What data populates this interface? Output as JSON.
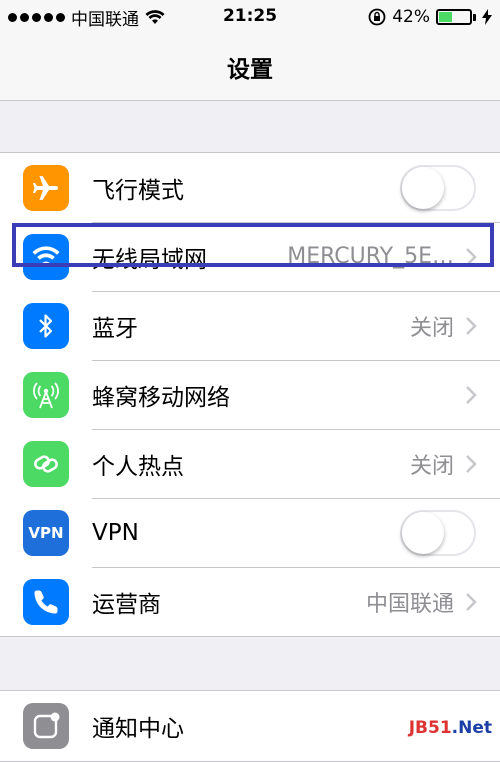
{
  "status_bar": {
    "carrier": "中国联通",
    "time": "21:25",
    "battery_percent": "42%",
    "battery_level": 0.42
  },
  "nav": {
    "title": "设置"
  },
  "settings": [
    {
      "label": "飞行模式",
      "icon": "airplane-icon",
      "icon_bg": "#ff9500",
      "type": "toggle",
      "on": false
    },
    {
      "label": "无线局域网",
      "icon": "wifi-icon",
      "icon_bg": "#007aff",
      "type": "detail",
      "value": "MERCURY_5E…"
    },
    {
      "label": "蓝牙",
      "icon": "bluetooth-icon",
      "icon_bg": "#007aff",
      "type": "detail",
      "value": "关闭"
    },
    {
      "label": "蜂窝移动网络",
      "icon": "cellular-icon",
      "icon_bg": "#4cd964",
      "type": "chevron"
    },
    {
      "label": "个人热点",
      "icon": "hotspot-icon",
      "icon_bg": "#4cd964",
      "type": "detail",
      "value": "关闭"
    },
    {
      "label": "VPN",
      "icon": "vpn-icon",
      "icon_bg": "#1e6fd9",
      "icon_text": "VPN",
      "type": "toggle",
      "on": false
    },
    {
      "label": "运营商",
      "icon": "phone-icon",
      "icon_bg": "#007aff",
      "type": "detail",
      "value": "中国联通"
    }
  ],
  "settings2": [
    {
      "label": "通知中心",
      "icon": "notification-center-icon",
      "icon_bg": "#8e8e93"
    }
  ],
  "watermark": {
    "brand": "JB51",
    "suffix": ".Net"
  },
  "colors": {
    "highlight": "#3b3db8",
    "battery": "#4cd964"
  }
}
